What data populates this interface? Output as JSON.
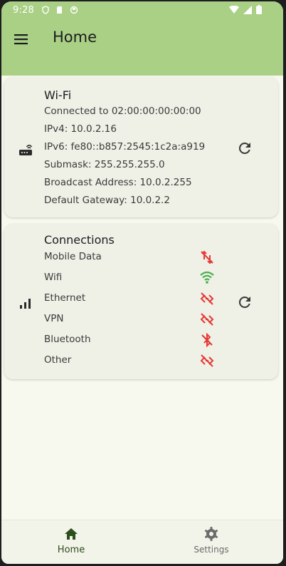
{
  "statusbar": {
    "time": "9:28"
  },
  "appbar": {
    "title": "Home"
  },
  "wifi_card": {
    "title": "Wi-Fi",
    "lines": [
      "Connected to 02:00:00:00:00:00",
      "IPv4: 10.0.2.16",
      "IPv6: fe80::b857:2545:1c2a:a919",
      "Submask: 255.255.255.0",
      "Broadcast Address: 10.0.2.255",
      "Default Gateway: 10.0.2.2"
    ]
  },
  "connections_card": {
    "title": "Connections",
    "items": [
      {
        "label": "Mobile Data",
        "status": "off",
        "icon": "mobile-data-off-icon"
      },
      {
        "label": "Wifi",
        "status": "on",
        "icon": "wifi-icon"
      },
      {
        "label": "Ethernet",
        "status": "off",
        "icon": "ethernet-off-icon"
      },
      {
        "label": "VPN",
        "status": "off",
        "icon": "vpn-off-icon"
      },
      {
        "label": "Bluetooth",
        "status": "off",
        "icon": "bluetooth-off-icon"
      },
      {
        "label": "Other",
        "status": "off",
        "icon": "other-off-icon"
      }
    ]
  },
  "bottom_nav": {
    "home_label": "Home",
    "settings_label": "Settings"
  },
  "colors": {
    "app_bar": "#a9d085",
    "background": "#f7f8ee",
    "card": "#eff0e6",
    "status_on": "#4caf50",
    "status_off": "#e53935",
    "nav_selected": "#2e4d1e"
  }
}
